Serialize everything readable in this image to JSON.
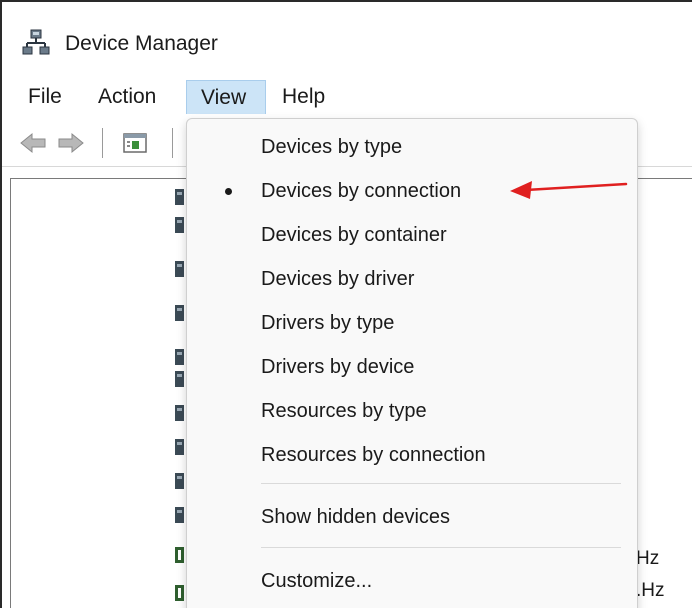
{
  "window": {
    "title": "Device Manager"
  },
  "menubar": {
    "items": [
      "File",
      "Action",
      "View",
      "Help"
    ],
    "active": "View"
  },
  "view_menu": {
    "items": [
      {
        "label": "Devices by type",
        "checked": false
      },
      {
        "label": "Devices by connection",
        "checked": true
      },
      {
        "label": "Devices by container",
        "checked": false
      },
      {
        "label": "Devices by driver",
        "checked": false
      },
      {
        "label": "Drivers by type",
        "checked": false
      },
      {
        "label": "Drivers by device",
        "checked": false
      },
      {
        "label": "Resources by type",
        "checked": false
      },
      {
        "label": "Resources by connection",
        "checked": false
      },
      {
        "label": "Show hidden devices",
        "checked": false
      },
      {
        "label": "Customize...",
        "checked": false
      }
    ]
  },
  "tree": {
    "partial_text": [
      "Hz",
      ".Hz"
    ]
  },
  "colors": {
    "menu_highlight": "#cce4f7",
    "annotation_arrow": "#e02020"
  }
}
